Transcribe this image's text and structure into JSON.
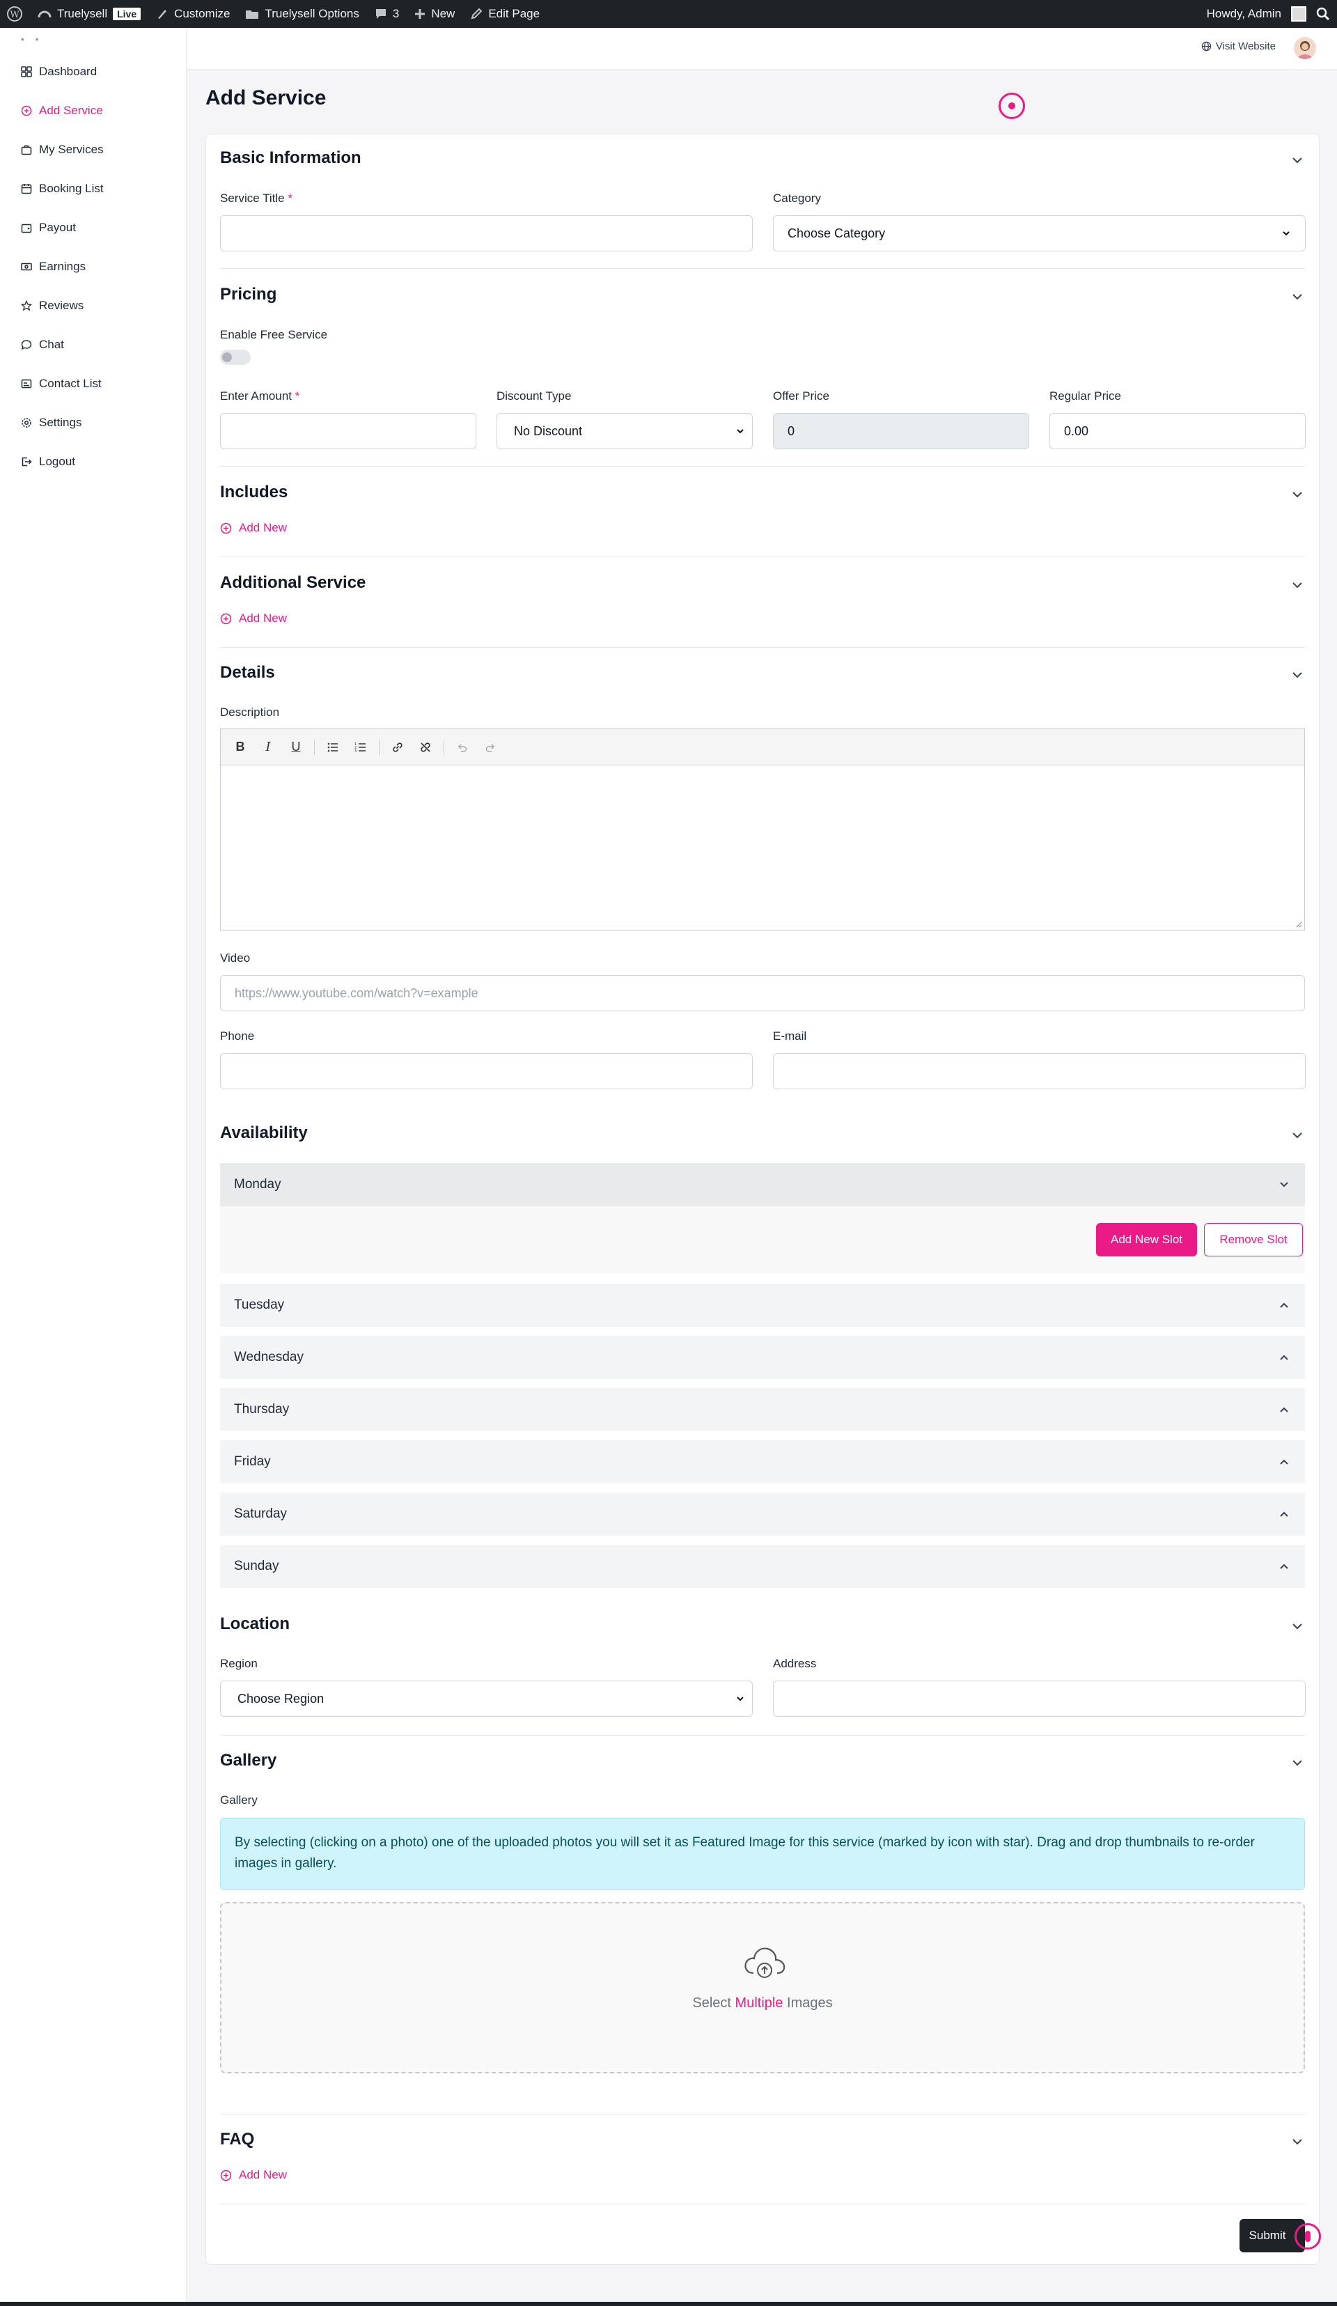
{
  "admin_bar": {
    "site_name": "Truelysell",
    "live_badge": "Live",
    "customize": "Customize",
    "options": "Truelysell Options",
    "comments_count": "3",
    "new": "New",
    "edit_page": "Edit Page",
    "howdy": "Howdy, Admin"
  },
  "sidebar": {
    "items": [
      {
        "label": "Dashboard",
        "icon": "grid-icon"
      },
      {
        "label": "Add Service",
        "icon": "plus-circle-icon"
      },
      {
        "label": "My Services",
        "icon": "briefcase-icon"
      },
      {
        "label": "Booking List",
        "icon": "calendar-icon"
      },
      {
        "label": "Payout",
        "icon": "wallet-icon"
      },
      {
        "label": "Earnings",
        "icon": "money-icon"
      },
      {
        "label": "Reviews",
        "icon": "star-icon"
      },
      {
        "label": "Chat",
        "icon": "chat-icon"
      },
      {
        "label": "Contact List",
        "icon": "contact-icon"
      },
      {
        "label": "Settings",
        "icon": "gear-icon"
      },
      {
        "label": "Logout",
        "icon": "logout-icon"
      }
    ]
  },
  "topbar": {
    "visit_website": "Visit Website"
  },
  "page": {
    "title": "Add Service"
  },
  "basic": {
    "title": "Basic Information",
    "service_title_label": "Service Title",
    "required_mark": "*",
    "category_label": "Category",
    "category_value": "Choose Category"
  },
  "pricing": {
    "title": "Pricing",
    "free_label": "Enable Free Service",
    "amount_label": "Enter Amount",
    "discount_label": "Discount Type",
    "discount_value": "No Discount",
    "offer_label": "Offer Price",
    "offer_value": "0",
    "regular_label": "Regular Price",
    "regular_value": "0.00"
  },
  "includes": {
    "title": "Includes",
    "add_new": "Add New"
  },
  "additional": {
    "title": "Additional Service",
    "add_new": "Add New"
  },
  "details": {
    "title": "Details",
    "description_label": "Description",
    "video_label": "Video",
    "video_placeholder": "https://www.youtube.com/watch?v=example",
    "phone_label": "Phone",
    "email_label": "E-mail"
  },
  "availability": {
    "title": "Availability",
    "days": [
      "Monday",
      "Tuesday",
      "Wednesday",
      "Thursday",
      "Friday",
      "Saturday",
      "Sunday"
    ],
    "add_slot": "Add New Slot",
    "remove_slot": "Remove Slot"
  },
  "location": {
    "title": "Location",
    "region_label": "Region",
    "region_value": "Choose Region",
    "address_label": "Address"
  },
  "gallery": {
    "title": "Gallery",
    "label": "Gallery",
    "notice": "By selecting (clicking on a photo) one of the uploaded photos you will set it as Featured Image for this service (marked by icon with star). Drag and drop thumbnails to re-order images in gallery.",
    "select_prefix": "Select",
    "select_highlight": "Multiple",
    "select_suffix": "Images"
  },
  "faq": {
    "title": "FAQ",
    "add_new": "Add New"
  },
  "submit": "Submit",
  "colors": {
    "accent": "#ea1b86",
    "admin_bar": "#1d2327",
    "info_bg": "#cff4fc"
  }
}
